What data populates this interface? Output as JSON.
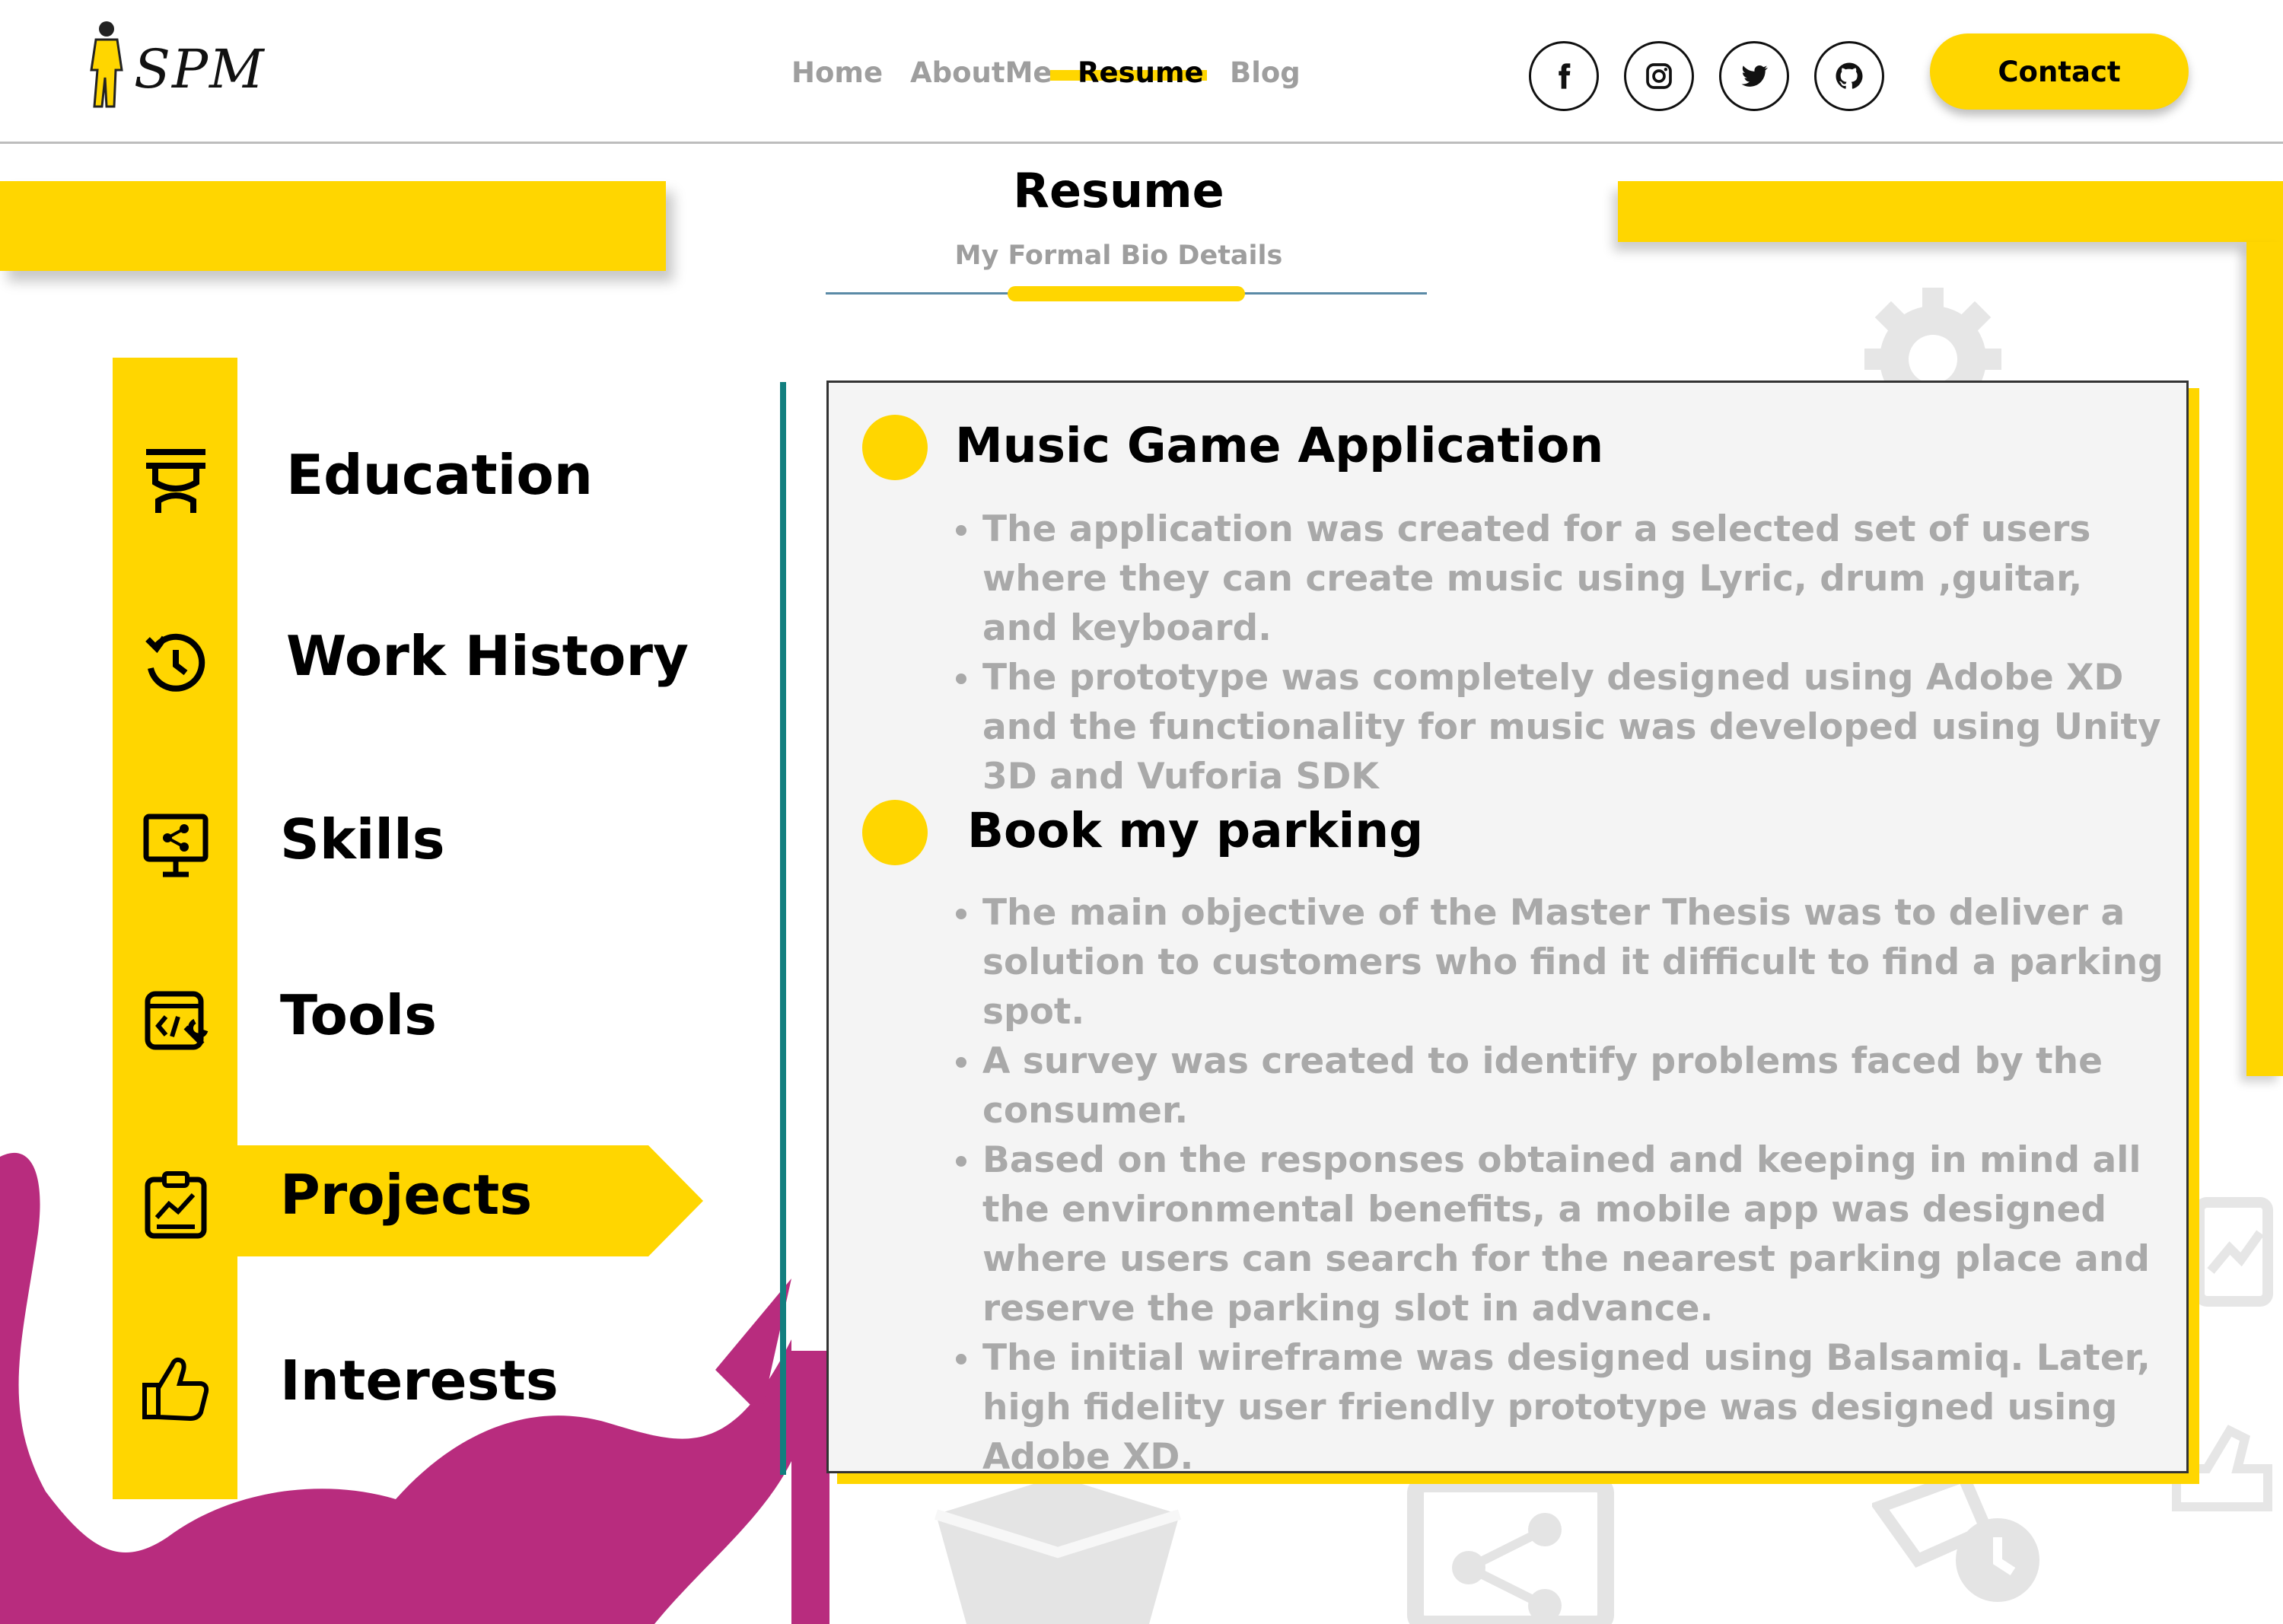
{
  "logo": {
    "text": "SPM"
  },
  "nav": {
    "items": [
      "Home",
      "AboutMe",
      "Resume",
      "Blog"
    ],
    "active": "Resume"
  },
  "social": [
    "facebook-icon",
    "instagram-icon",
    "twitter-icon",
    "github-icon"
  ],
  "contact_label": "Contact",
  "section": {
    "title": "Resume",
    "subtitle": "My Formal Bio Details"
  },
  "sidebar": {
    "items": [
      {
        "label": "Education",
        "icon": "graduation-icon"
      },
      {
        "label": "Work History",
        "icon": "history-icon"
      },
      {
        "label": "Skills",
        "icon": "presentation-share-icon"
      },
      {
        "label": "Tools",
        "icon": "code-wrench-icon"
      },
      {
        "label": "Projects",
        "icon": "clipboard-chart-icon"
      },
      {
        "label": "Interests",
        "icon": "thumbs-up-icon"
      }
    ],
    "active": "Projects"
  },
  "projects": [
    {
      "title": "Music Game Application",
      "bullets": [
        "The application was created for a selected set of users where they can create music using Lyric, drum ,guitar, and keyboard.",
        "The prototype was completely designed using Adobe XD and the functionality for music was developed using Unity 3D and Vuforia SDK"
      ]
    },
    {
      "title": "Book my parking",
      "bullets": [
        "The main objective of the Master Thesis was to deliver a solution to customers who find it difficult to find a parking spot.",
        "A survey was created to identify problems faced by the consumer.",
        "Based on the responses obtained and keeping in mind all the environmental benefits, a mobile app was designed where users can search for the nearest parking place and reserve the parking slot in advance.",
        "The initial wireframe was designed using Balsamiq. Later, high fidelity user friendly prototype was designed using Adobe XD."
      ]
    }
  ],
  "colors": {
    "accent": "#FFD600",
    "magenta": "#B82C7E",
    "teal": "#127F7F",
    "muted_text": "#A9A9A9"
  }
}
